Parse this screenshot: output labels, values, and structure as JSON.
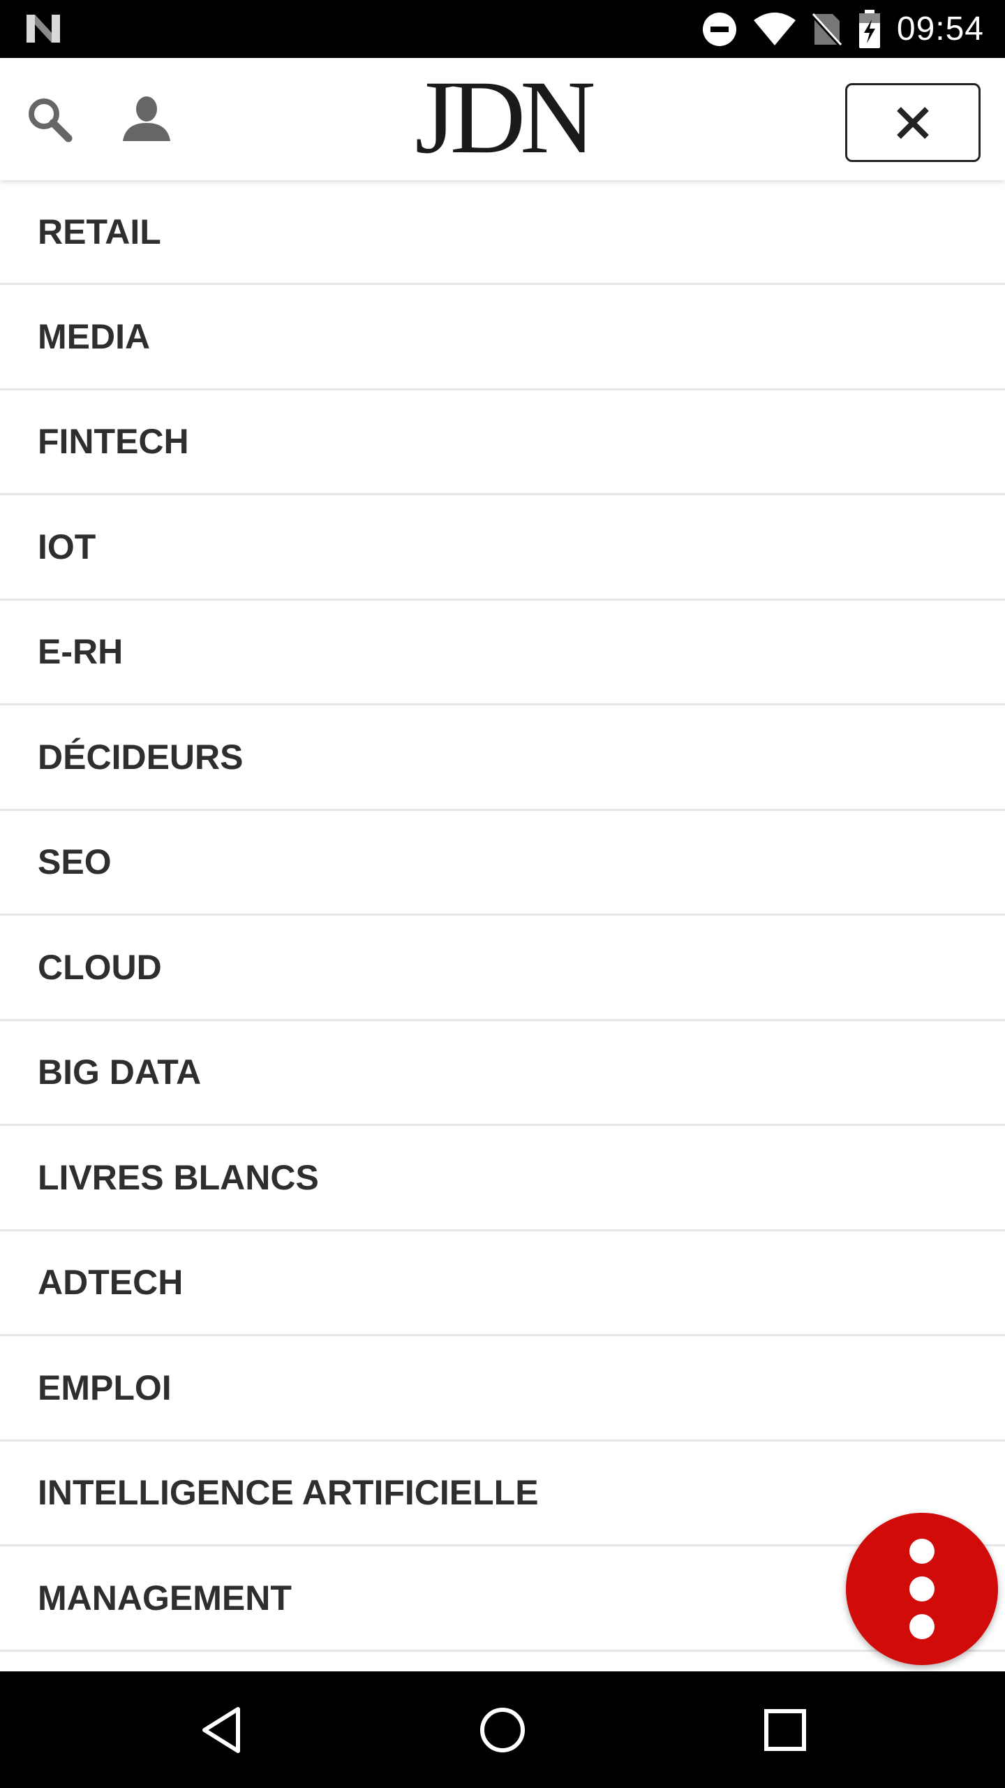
{
  "status_bar": {
    "time": "09:54",
    "icons": [
      "notification-n-icon",
      "do-not-disturb-icon",
      "wifi-icon",
      "no-sim-icon",
      "battery-charging-icon"
    ]
  },
  "header": {
    "logo": "JDN",
    "icons": [
      "search-icon",
      "user-icon",
      "close-icon"
    ]
  },
  "menu": {
    "items": [
      {
        "label": "RETAIL"
      },
      {
        "label": "MEDIA"
      },
      {
        "label": "FINTECH"
      },
      {
        "label": "IOT"
      },
      {
        "label": "E-RH"
      },
      {
        "label": "DÉCIDEURS"
      },
      {
        "label": "SEO"
      },
      {
        "label": "CLOUD"
      },
      {
        "label": "BIG DATA"
      },
      {
        "label": "LIVRES BLANCS"
      },
      {
        "label": "ADTECH"
      },
      {
        "label": "EMPLOI"
      },
      {
        "label": "INTELLIGENCE ARTIFICIELLE"
      },
      {
        "label": "MANAGEMENT"
      }
    ]
  },
  "fab": {
    "icon": "more-vertical-icon",
    "color": "#d10a0a"
  },
  "nav_bar": {
    "icons": [
      "back-icon",
      "home-icon",
      "recents-icon"
    ]
  }
}
